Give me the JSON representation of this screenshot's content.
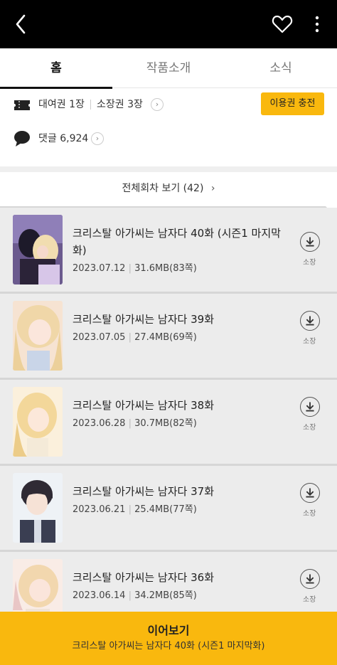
{
  "header": {
    "back_icon": "back-arrow-icon",
    "heart_icon": "heart-outline-icon",
    "more_icon": "more-vertical-icon"
  },
  "tabs": [
    {
      "label": "홈",
      "active": true
    },
    {
      "label": "작품소개",
      "active": false
    },
    {
      "label": "소식",
      "active": false
    }
  ],
  "info": {
    "rent_label": "대여권 1장",
    "own_label": "소장권 3장",
    "charge_button": "이용권 충전",
    "comments_label": "댓글 6,924"
  },
  "all_episodes_label": "전체회차 보기 (42)",
  "episodes": [
    {
      "title": "크리스탈 아가씨는 남자다 40화 (시즌1 마지막화)",
      "date": "2023.07.12",
      "size": "31.6MB(83쪽)",
      "download_label": "소장"
    },
    {
      "title": "크리스탈 아가씨는 남자다 39화",
      "date": "2023.07.05",
      "size": "27.4MB(69쪽)",
      "download_label": "소장"
    },
    {
      "title": "크리스탈 아가씨는 남자다 38화",
      "date": "2023.06.28",
      "size": "30.7MB(82쪽)",
      "download_label": "소장"
    },
    {
      "title": "크리스탈 아가씨는 남자다 37화",
      "date": "2023.06.21",
      "size": "25.4MB(77쪽)",
      "download_label": "소장"
    },
    {
      "title": "크리스탈 아가씨는 남자다 36화",
      "date": "2023.06.14",
      "size": "34.2MB(85쪽)",
      "download_label": "소장"
    }
  ],
  "continue": {
    "label": "이어보기",
    "subtitle": "크리스탈 아가씨는 남자다 40화 (시즌1 마지막화)"
  },
  "colors": {
    "accent": "#f9b80e",
    "header_bg": "#000000",
    "list_bg": "#ececec"
  }
}
